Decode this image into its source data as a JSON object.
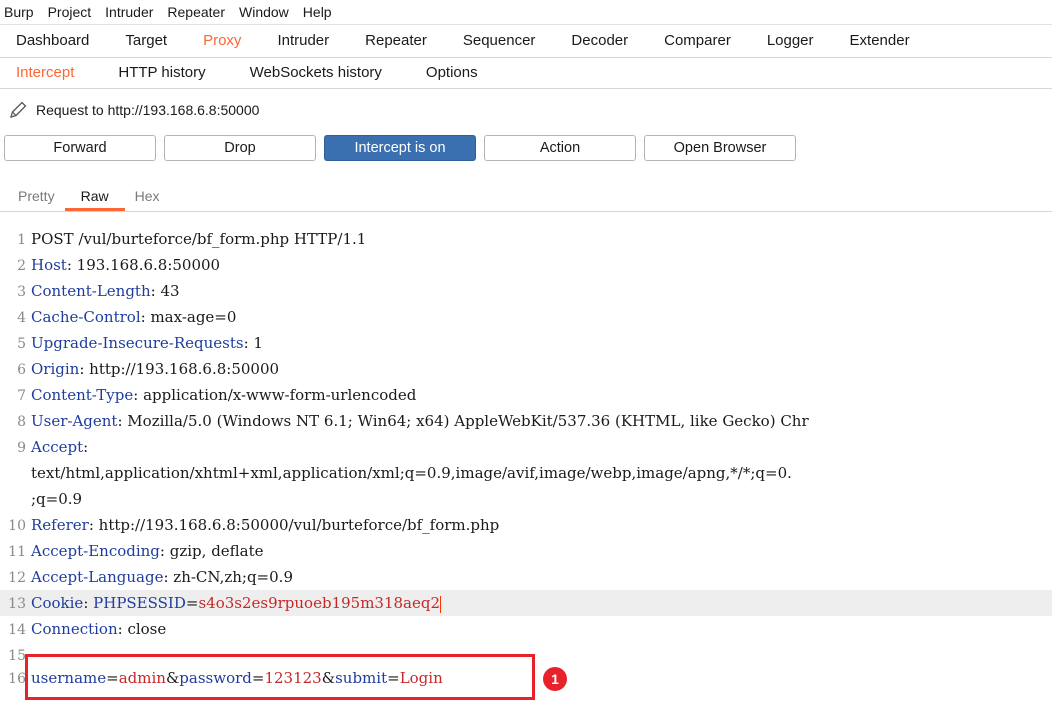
{
  "menubar": [
    "Burp",
    "Project",
    "Intruder",
    "Repeater",
    "Window",
    "Help"
  ],
  "tabs": [
    "Dashboard",
    "Target",
    "Proxy",
    "Intruder",
    "Repeater",
    "Sequencer",
    "Decoder",
    "Comparer",
    "Logger",
    "Extender"
  ],
  "active_tab": "Proxy",
  "subtabs": [
    "Intercept",
    "HTTP history",
    "WebSockets history",
    "Options"
  ],
  "active_subtab": "Intercept",
  "request_label": "Request to http://193.168.6.8:50000",
  "buttons": {
    "forward": "Forward",
    "drop": "Drop",
    "intercept": "Intercept is on",
    "action": "Action",
    "open_browser": "Open Browser"
  },
  "view_tabs": [
    "Pretty",
    "Raw",
    "Hex"
  ],
  "active_view": "Raw",
  "request_lines": [
    {
      "n": "1",
      "text": "POST /vul/burteforce/bf_form.php HTTP/1.1"
    },
    {
      "n": "2",
      "name": "Host",
      "value": " 193.168.6.8:50000"
    },
    {
      "n": "3",
      "name": "Content-Length",
      "value": " 43"
    },
    {
      "n": "4",
      "name": "Cache-Control",
      "value": " max-age=0"
    },
    {
      "n": "5",
      "name": "Upgrade-Insecure-Requests",
      "value": " 1"
    },
    {
      "n": "6",
      "name": "Origin",
      "value": " http://193.168.6.8:50000"
    },
    {
      "n": "7",
      "name": "Content-Type",
      "value": " application/x-www-form-urlencoded"
    },
    {
      "n": "8",
      "name": "User-Agent",
      "value": " Mozilla/5.0 (Windows NT 6.1; Win64; x64) AppleWebKit/537.36 (KHTML, like Gecko) Chr"
    },
    {
      "n": "9",
      "name": "Accept",
      "value": ""
    },
    {
      "n": "",
      "text": "text/html,application/xhtml+xml,application/xml;q=0.9,image/avif,image/webp,image/apng,*/*;q=0."
    },
    {
      "n": "",
      "text": ";q=0.9"
    },
    {
      "n": "10",
      "name": "Referer",
      "value": " http://193.168.6.8:50000/vul/burteforce/bf_form.php"
    },
    {
      "n": "11",
      "name": "Accept-Encoding",
      "value": " gzip, deflate"
    },
    {
      "n": "12",
      "name": "Accept-Language",
      "value": " zh-CN,zh;q=0.9"
    },
    {
      "n": "13",
      "name": "Cookie",
      "cookie_name": "PHPSESSID",
      "cookie_value": "s4o3s2es9rpuoeb195m318aeq2"
    },
    {
      "n": "14",
      "name": "Connection",
      "value": " close"
    },
    {
      "n": "15",
      "text": ""
    },
    {
      "n": "16",
      "params": [
        {
          "name": "username",
          "value": "admin"
        },
        {
          "name": "password",
          "value": "123123"
        },
        {
          "name": "submit",
          "value": "Login"
        }
      ]
    }
  ],
  "annotation_badge": "1",
  "colors": {
    "accent": "#ff6633",
    "primary_button": "#3a6fb0",
    "annotation": "#e8222b"
  }
}
